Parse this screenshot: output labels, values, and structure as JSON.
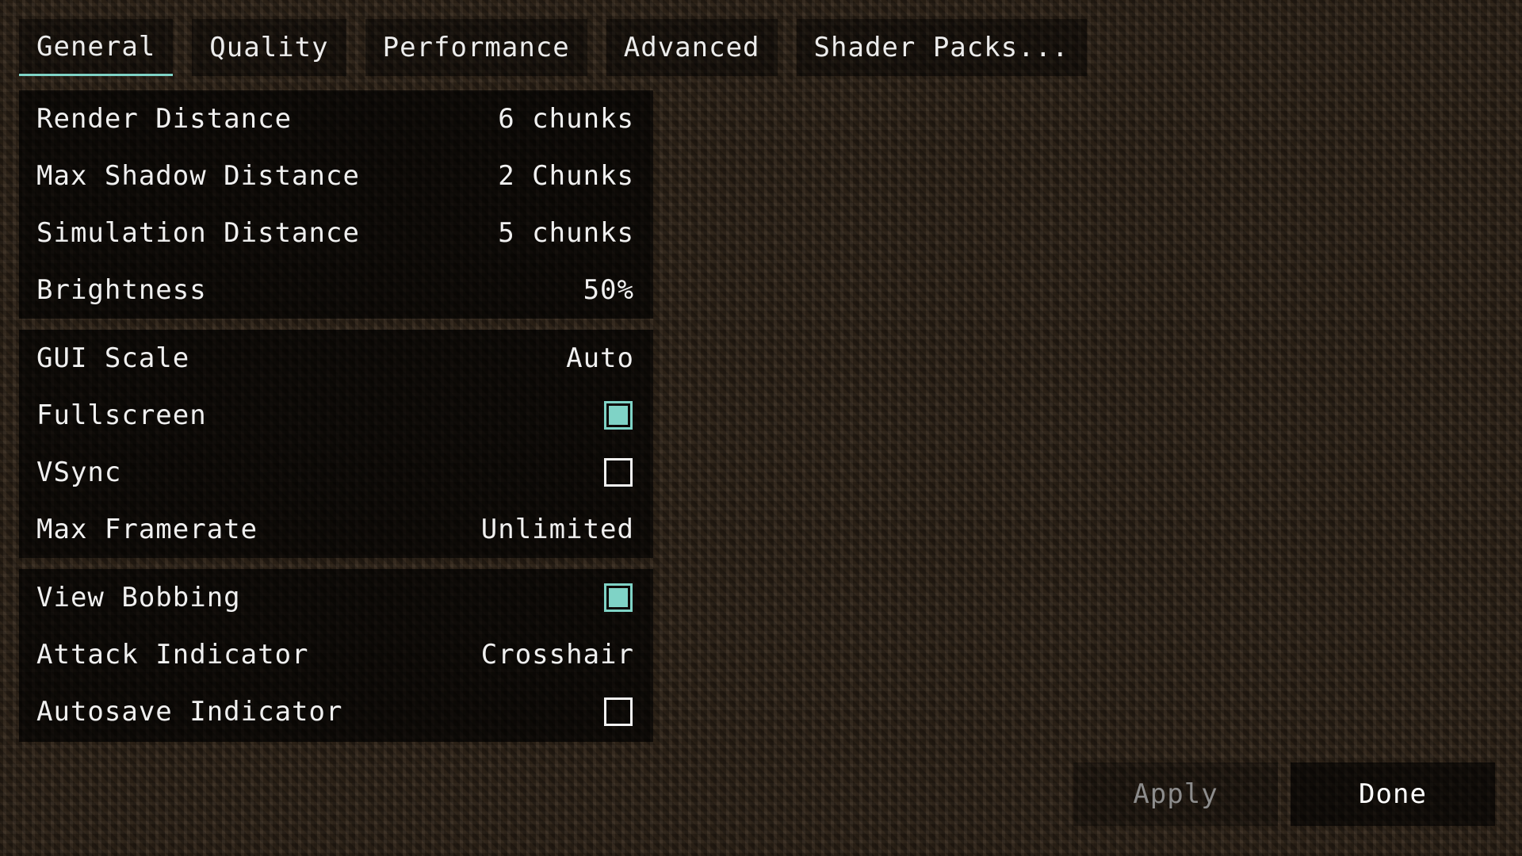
{
  "tabs": [
    {
      "label": "General",
      "active": true
    },
    {
      "label": "Quality",
      "active": false
    },
    {
      "label": "Performance",
      "active": false
    },
    {
      "label": "Advanced",
      "active": false
    },
    {
      "label": "Shader Packs..."
    }
  ],
  "groups": [
    {
      "rows": [
        {
          "label": "Render Distance",
          "value": "6 chunks"
        },
        {
          "label": "Max Shadow Distance",
          "value": "2 Chunks"
        },
        {
          "label": "Simulation Distance",
          "value": "5 chunks"
        },
        {
          "label": "Brightness",
          "value": "50%"
        }
      ]
    },
    {
      "rows": [
        {
          "label": "GUI Scale",
          "value": "Auto"
        },
        {
          "label": "Fullscreen",
          "checked": true
        },
        {
          "label": "VSync",
          "checked": false
        },
        {
          "label": "Max Framerate",
          "value": "Unlimited"
        }
      ]
    },
    {
      "rows": [
        {
          "label": "View Bobbing",
          "checked": true
        },
        {
          "label": "Attack Indicator",
          "value": "Crosshair"
        },
        {
          "label": "Autosave Indicator",
          "checked": false
        }
      ]
    }
  ],
  "footer": {
    "apply_label": "Apply",
    "done_label": "Done"
  },
  "colors": {
    "accent": "#7fd3c6",
    "disabled_text": "#8c8c8c"
  }
}
